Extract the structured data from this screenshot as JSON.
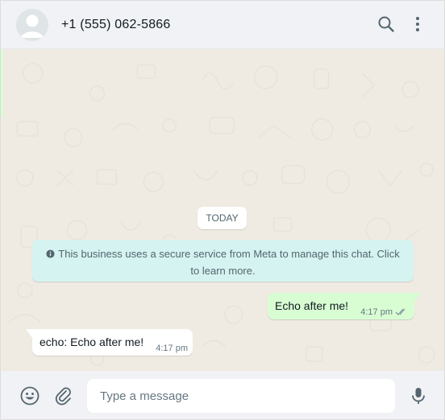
{
  "header": {
    "contact_name": "+1 (555) 062-5866",
    "icons": [
      "avatar-icon",
      "search-icon",
      "menu-icon"
    ]
  },
  "chat": {
    "date_chip": "TODAY",
    "system_message": {
      "icon": "info-icon",
      "text": "This business uses a secure service from Meta to manage this chat. Click to learn more."
    },
    "messages": [
      {
        "direction": "outgoing",
        "text": "Echo after me!",
        "time": "4:17 pm",
        "status": "read"
      },
      {
        "direction": "incoming",
        "text": "echo: Echo after me!",
        "time": "4:17 pm"
      }
    ]
  },
  "composer": {
    "placeholder": "Type a message",
    "value": "",
    "icons": [
      "emoji-icon",
      "attach-icon",
      "mic-icon"
    ]
  },
  "colors": {
    "header_bg": "#f0f2f5",
    "chat_bg": "#efeae2",
    "outgoing_bubble": "#d9fdd3",
    "incoming_bubble": "#ffffff",
    "system_bubble": "#d5f3f0",
    "read_ticks": "#53bdeb",
    "icon": "#54656f"
  }
}
